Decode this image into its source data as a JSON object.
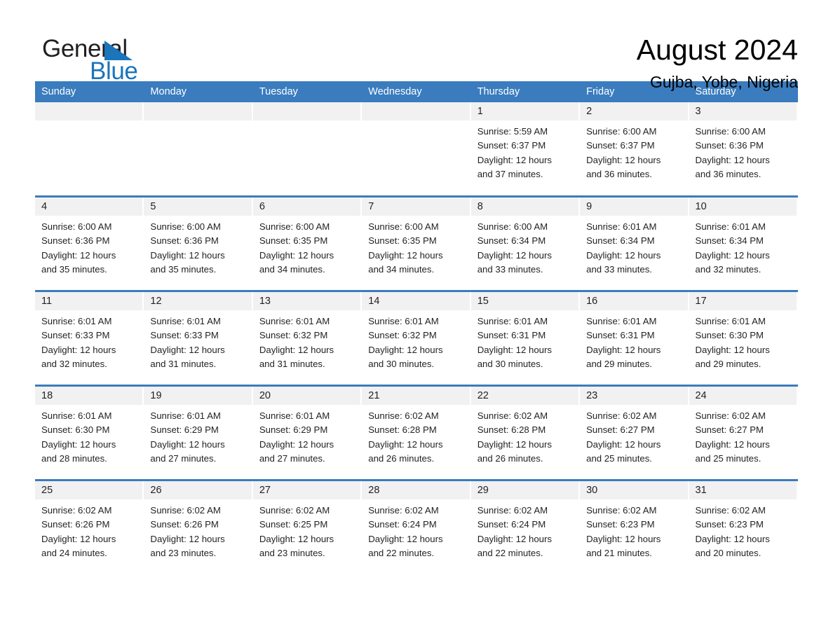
{
  "logo": {
    "word_one": "General",
    "word_two": "Blue",
    "accent_color": "#1b75bb",
    "triangle_icon": "triangle-icon"
  },
  "header": {
    "title": "August 2024",
    "location": "Gujba, Yobe, Nigeria"
  },
  "calendar": {
    "header_bg": "#3a7cbe",
    "daynum_bg": "#f1f1f1",
    "weekdays": [
      "Sunday",
      "Monday",
      "Tuesday",
      "Wednesday",
      "Thursday",
      "Friday",
      "Saturday"
    ],
    "labels": {
      "sunrise": "Sunrise:",
      "sunset": "Sunset:",
      "daylight": "Daylight:"
    },
    "weeks": [
      [
        {
          "day": "",
          "sunrise": "",
          "sunset": "",
          "daylight_line1": "",
          "daylight_line2": ""
        },
        {
          "day": "",
          "sunrise": "",
          "sunset": "",
          "daylight_line1": "",
          "daylight_line2": ""
        },
        {
          "day": "",
          "sunrise": "",
          "sunset": "",
          "daylight_line1": "",
          "daylight_line2": ""
        },
        {
          "day": "",
          "sunrise": "",
          "sunset": "",
          "daylight_line1": "",
          "daylight_line2": ""
        },
        {
          "day": "1",
          "sunrise": "Sunrise: 5:59 AM",
          "sunset": "Sunset: 6:37 PM",
          "daylight_line1": "Daylight: 12 hours",
          "daylight_line2": "and 37 minutes."
        },
        {
          "day": "2",
          "sunrise": "Sunrise: 6:00 AM",
          "sunset": "Sunset: 6:37 PM",
          "daylight_line1": "Daylight: 12 hours",
          "daylight_line2": "and 36 minutes."
        },
        {
          "day": "3",
          "sunrise": "Sunrise: 6:00 AM",
          "sunset": "Sunset: 6:36 PM",
          "daylight_line1": "Daylight: 12 hours",
          "daylight_line2": "and 36 minutes."
        }
      ],
      [
        {
          "day": "4",
          "sunrise": "Sunrise: 6:00 AM",
          "sunset": "Sunset: 6:36 PM",
          "daylight_line1": "Daylight: 12 hours",
          "daylight_line2": "and 35 minutes."
        },
        {
          "day": "5",
          "sunrise": "Sunrise: 6:00 AM",
          "sunset": "Sunset: 6:36 PM",
          "daylight_line1": "Daylight: 12 hours",
          "daylight_line2": "and 35 minutes."
        },
        {
          "day": "6",
          "sunrise": "Sunrise: 6:00 AM",
          "sunset": "Sunset: 6:35 PM",
          "daylight_line1": "Daylight: 12 hours",
          "daylight_line2": "and 34 minutes."
        },
        {
          "day": "7",
          "sunrise": "Sunrise: 6:00 AM",
          "sunset": "Sunset: 6:35 PM",
          "daylight_line1": "Daylight: 12 hours",
          "daylight_line2": "and 34 minutes."
        },
        {
          "day": "8",
          "sunrise": "Sunrise: 6:00 AM",
          "sunset": "Sunset: 6:34 PM",
          "daylight_line1": "Daylight: 12 hours",
          "daylight_line2": "and 33 minutes."
        },
        {
          "day": "9",
          "sunrise": "Sunrise: 6:01 AM",
          "sunset": "Sunset: 6:34 PM",
          "daylight_line1": "Daylight: 12 hours",
          "daylight_line2": "and 33 minutes."
        },
        {
          "day": "10",
          "sunrise": "Sunrise: 6:01 AM",
          "sunset": "Sunset: 6:34 PM",
          "daylight_line1": "Daylight: 12 hours",
          "daylight_line2": "and 32 minutes."
        }
      ],
      [
        {
          "day": "11",
          "sunrise": "Sunrise: 6:01 AM",
          "sunset": "Sunset: 6:33 PM",
          "daylight_line1": "Daylight: 12 hours",
          "daylight_line2": "and 32 minutes."
        },
        {
          "day": "12",
          "sunrise": "Sunrise: 6:01 AM",
          "sunset": "Sunset: 6:33 PM",
          "daylight_line1": "Daylight: 12 hours",
          "daylight_line2": "and 31 minutes."
        },
        {
          "day": "13",
          "sunrise": "Sunrise: 6:01 AM",
          "sunset": "Sunset: 6:32 PM",
          "daylight_line1": "Daylight: 12 hours",
          "daylight_line2": "and 31 minutes."
        },
        {
          "day": "14",
          "sunrise": "Sunrise: 6:01 AM",
          "sunset": "Sunset: 6:32 PM",
          "daylight_line1": "Daylight: 12 hours",
          "daylight_line2": "and 30 minutes."
        },
        {
          "day": "15",
          "sunrise": "Sunrise: 6:01 AM",
          "sunset": "Sunset: 6:31 PM",
          "daylight_line1": "Daylight: 12 hours",
          "daylight_line2": "and 30 minutes."
        },
        {
          "day": "16",
          "sunrise": "Sunrise: 6:01 AM",
          "sunset": "Sunset: 6:31 PM",
          "daylight_line1": "Daylight: 12 hours",
          "daylight_line2": "and 29 minutes."
        },
        {
          "day": "17",
          "sunrise": "Sunrise: 6:01 AM",
          "sunset": "Sunset: 6:30 PM",
          "daylight_line1": "Daylight: 12 hours",
          "daylight_line2": "and 29 minutes."
        }
      ],
      [
        {
          "day": "18",
          "sunrise": "Sunrise: 6:01 AM",
          "sunset": "Sunset: 6:30 PM",
          "daylight_line1": "Daylight: 12 hours",
          "daylight_line2": "and 28 minutes."
        },
        {
          "day": "19",
          "sunrise": "Sunrise: 6:01 AM",
          "sunset": "Sunset: 6:29 PM",
          "daylight_line1": "Daylight: 12 hours",
          "daylight_line2": "and 27 minutes."
        },
        {
          "day": "20",
          "sunrise": "Sunrise: 6:01 AM",
          "sunset": "Sunset: 6:29 PM",
          "daylight_line1": "Daylight: 12 hours",
          "daylight_line2": "and 27 minutes."
        },
        {
          "day": "21",
          "sunrise": "Sunrise: 6:02 AM",
          "sunset": "Sunset: 6:28 PM",
          "daylight_line1": "Daylight: 12 hours",
          "daylight_line2": "and 26 minutes."
        },
        {
          "day": "22",
          "sunrise": "Sunrise: 6:02 AM",
          "sunset": "Sunset: 6:28 PM",
          "daylight_line1": "Daylight: 12 hours",
          "daylight_line2": "and 26 minutes."
        },
        {
          "day": "23",
          "sunrise": "Sunrise: 6:02 AM",
          "sunset": "Sunset: 6:27 PM",
          "daylight_line1": "Daylight: 12 hours",
          "daylight_line2": "and 25 minutes."
        },
        {
          "day": "24",
          "sunrise": "Sunrise: 6:02 AM",
          "sunset": "Sunset: 6:27 PM",
          "daylight_line1": "Daylight: 12 hours",
          "daylight_line2": "and 25 minutes."
        }
      ],
      [
        {
          "day": "25",
          "sunrise": "Sunrise: 6:02 AM",
          "sunset": "Sunset: 6:26 PM",
          "daylight_line1": "Daylight: 12 hours",
          "daylight_line2": "and 24 minutes."
        },
        {
          "day": "26",
          "sunrise": "Sunrise: 6:02 AM",
          "sunset": "Sunset: 6:26 PM",
          "daylight_line1": "Daylight: 12 hours",
          "daylight_line2": "and 23 minutes."
        },
        {
          "day": "27",
          "sunrise": "Sunrise: 6:02 AM",
          "sunset": "Sunset: 6:25 PM",
          "daylight_line1": "Daylight: 12 hours",
          "daylight_line2": "and 23 minutes."
        },
        {
          "day": "28",
          "sunrise": "Sunrise: 6:02 AM",
          "sunset": "Sunset: 6:24 PM",
          "daylight_line1": "Daylight: 12 hours",
          "daylight_line2": "and 22 minutes."
        },
        {
          "day": "29",
          "sunrise": "Sunrise: 6:02 AM",
          "sunset": "Sunset: 6:24 PM",
          "daylight_line1": "Daylight: 12 hours",
          "daylight_line2": "and 22 minutes."
        },
        {
          "day": "30",
          "sunrise": "Sunrise: 6:02 AM",
          "sunset": "Sunset: 6:23 PM",
          "daylight_line1": "Daylight: 12 hours",
          "daylight_line2": "and 21 minutes."
        },
        {
          "day": "31",
          "sunrise": "Sunrise: 6:02 AM",
          "sunset": "Sunset: 6:23 PM",
          "daylight_line1": "Daylight: 12 hours",
          "daylight_line2": "and 20 minutes."
        }
      ]
    ]
  }
}
